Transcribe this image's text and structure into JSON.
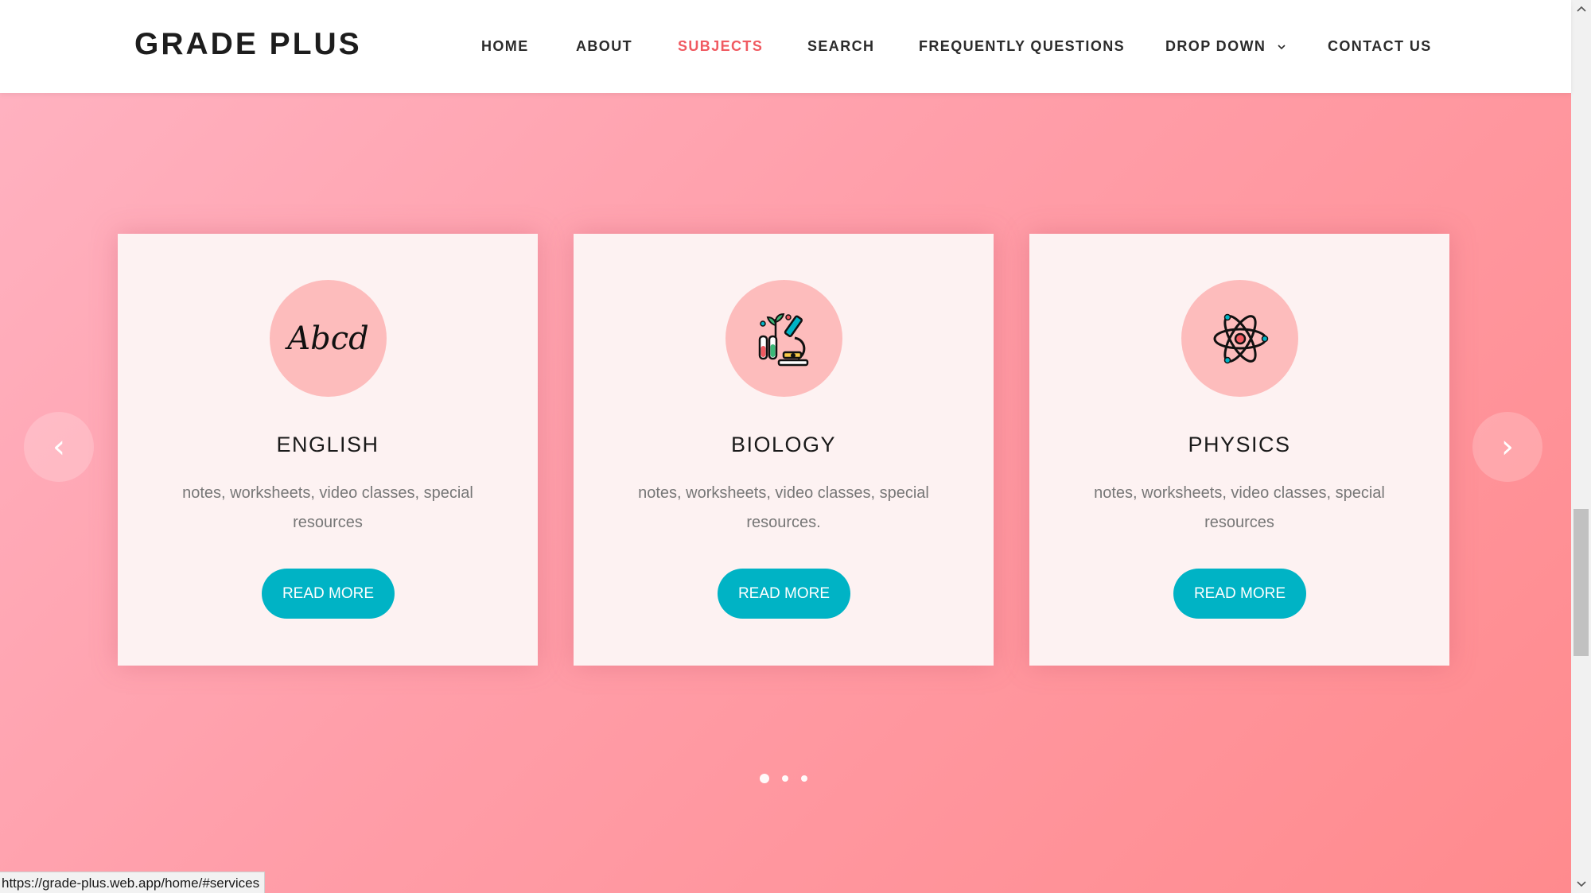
{
  "brand": "GRADE PLUS",
  "nav": {
    "home": "HOME",
    "about": "ABOUT",
    "subjects": "SUBJECTS",
    "search": "SEARCH",
    "faq": "FREQUENTLY QUESTIONS",
    "dropdown": "DROP DOWN",
    "contact": "CONTACT US",
    "active_item": "SUBJECTS",
    "active_color": "#f05a61"
  },
  "cards": [
    {
      "title": "ENGLISH",
      "description": "notes, worksheets, video classes, special resources",
      "button": "READ MORE",
      "icon": "abcd-script-icon",
      "icon_text": "Abcd"
    },
    {
      "title": "BIOLOGY",
      "description": "notes, worksheets, video classes, special resources.",
      "button": "READ MORE",
      "icon": "microscope-icon"
    },
    {
      "title": "PHYSICS",
      "description": "notes, worksheets, video classes, special resources",
      "button": "READ MORE",
      "icon": "atom-icon"
    }
  ],
  "carousel": {
    "prev_glyph": "‹",
    "next_glyph": "›",
    "dots": 3,
    "active_dot": 1
  },
  "status_url": "https://grade-plus.web.app/home/#services",
  "colors": {
    "button": "#00b3c5",
    "icon_circle": "#fdbcbc",
    "card_bg": "#fdf2f2",
    "background_start": "#ffb3c2",
    "background_end": "#ff8a8d"
  }
}
